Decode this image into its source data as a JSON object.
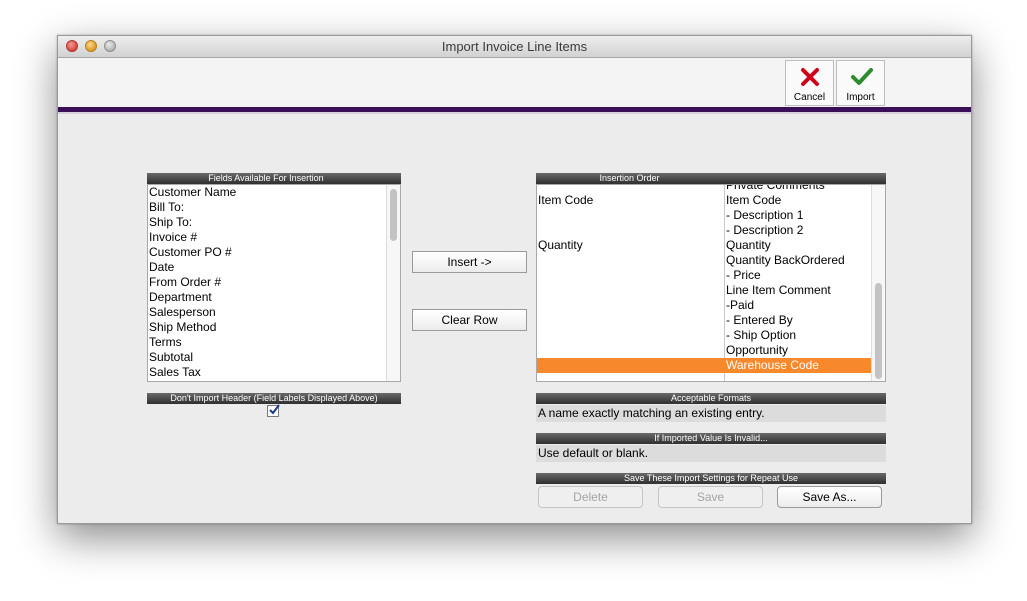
{
  "window": {
    "title": "Import Invoice Line Items"
  },
  "toolbar": {
    "cancel_label": "Cancel",
    "import_label": "Import"
  },
  "fields_available": {
    "header": "Fields Available For Insertion",
    "items": [
      "Customer Name",
      "Bill To:",
      "Ship To:",
      "Invoice #",
      "Customer PO #",
      "Date",
      "From Order #",
      "Department",
      "Salesperson",
      "Ship Method",
      "Terms",
      "Subtotal",
      "Sales Tax"
    ]
  },
  "dont_import_header": {
    "label": "Don't Import Header (Field Labels Displayed Above)",
    "checked": true
  },
  "buttons": {
    "insert": "Insert ->",
    "clear_row": "Clear Row"
  },
  "insertion_order": {
    "header": "Insertion Order",
    "rows": [
      {
        "source": "",
        "target": "Private Comments"
      },
      {
        "source": "Item Code",
        "target": "Item Code"
      },
      {
        "source": "",
        "target": "- Description 1"
      },
      {
        "source": "",
        "target": "- Description 2"
      },
      {
        "source": "Quantity",
        "target": "Quantity"
      },
      {
        "source": "",
        "target": "Quantity BackOrdered"
      },
      {
        "source": "",
        "target": "- Price"
      },
      {
        "source": "",
        "target": "Line Item Comment"
      },
      {
        "source": "",
        "target": "-Paid"
      },
      {
        "source": "",
        "target": "- Entered By"
      },
      {
        "source": "",
        "target": "- Ship Option"
      },
      {
        "source": "",
        "target": "Opportunity"
      },
      {
        "source": "",
        "target": "Warehouse Code"
      }
    ],
    "selected_index": 12,
    "selection_color": "#f7892c"
  },
  "acceptable_formats": {
    "header": "Acceptable Formats",
    "value": "A name exactly matching an existing entry."
  },
  "invalid_value": {
    "header": "If Imported Value Is Invalid...",
    "value": "Use default or blank."
  },
  "save_settings": {
    "header": "Save These Import Settings for Repeat Use",
    "delete": "Delete",
    "save": "Save",
    "save_as": "Save As..."
  },
  "colors": {
    "accent_bar": "#3a0f58",
    "cancel_red": "#d0021b",
    "import_green": "#2e8b2e"
  }
}
